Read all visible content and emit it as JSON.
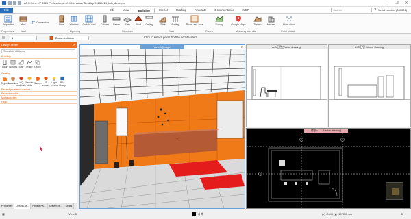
{
  "window": {
    "title": "ARCHLine.XP 2023 Professional - C:\\Users\\user\\Desktop\\20231229_info_deck.pro",
    "controls": [
      "—",
      "❐",
      "✕"
    ]
  },
  "menu": {
    "tabs": [
      "File",
      "Edit",
      "View",
      "Building",
      "Interior",
      "Drafting",
      "Annotate",
      "Documentation",
      "MEP"
    ],
    "active_tab": "Building",
    "search_placeholder": "Search",
    "serial": "Serial number (030001)"
  },
  "ribbon": {
    "buttons": [
      {
        "label": "Properties",
        "icon": "properties-icon"
      },
      {
        "label": "Wall",
        "icon": "wall-icon"
      },
      {
        "label": "Connection",
        "icon": "connection-icon"
      },
      {
        "label": "Door",
        "icon": "door-icon"
      },
      {
        "label": "Window",
        "icon": "window-icon"
      },
      {
        "label": "Curtain wall",
        "icon": "curtain-wall-icon"
      },
      {
        "label": "Column",
        "icon": "column-icon"
      },
      {
        "label": "Beam",
        "icon": "beam-icon"
      },
      {
        "label": "Slab",
        "icon": "slab-icon"
      },
      {
        "label": "Roof",
        "icon": "roof-icon"
      },
      {
        "label": "Ceiling",
        "icon": "ceiling-icon"
      },
      {
        "label": "Stair",
        "icon": "stair-icon"
      },
      {
        "label": "Railing",
        "icon": "railing-icon"
      },
      {
        "label": "Room and area",
        "icon": "room-icon"
      },
      {
        "label": "Survey",
        "icon": "survey-icon"
      },
      {
        "label": "Google Maps",
        "icon": "map-icon"
      },
      {
        "label": "Terrain",
        "icon": "terrain-icon"
      },
      {
        "label": "Masses",
        "icon": "masses-icon"
      },
      {
        "label": "Point cloud",
        "icon": "point-cloud-icon"
      }
    ],
    "groups": [
      "Properties",
      "Wall",
      "Opening",
      "Structure",
      "Stair",
      "Room",
      "Massing and site",
      "Point cloud"
    ]
  },
  "toolbar2": {
    "layer_value": "1",
    "style_value": "Documentation",
    "hint": "Click to select, press Shift to add/deselect"
  },
  "left_panel": {
    "title": "Design center",
    "search_placeholder": "Search in all items",
    "building_label": "Building",
    "building_items": [
      "Door",
      "Window",
      "Stair",
      "Profile",
      "Group"
    ],
    "catalog_label": "Catalog",
    "catalog_items": [
      "Objects",
      "Materials",
      "HQ materials",
      "Render style",
      "Shower",
      "3D scenes",
      "Light source",
      "BIM library"
    ],
    "sections": [
      "Recently created content",
      "Recent models",
      "My favourites",
      "Help"
    ],
    "bottom_tabs": [
      "Properties",
      "Design ce...",
      "Project na...",
      "System br...",
      "Styles"
    ]
  },
  "views": {
    "view3d_title": "View 3 [Image]",
    "top_left_title": "A-A 단면 [Vector drawing]",
    "top_right_title": "C-C 단면 [Vector drawing]",
    "bottom_title": "평면도 - 1 [Vector drawing]"
  },
  "status": {
    "view_label": "View 3",
    "layer_label": "가벽",
    "coords": "(x) -2446  (y) -1075.2 mm"
  },
  "colors": {
    "accent": "#f06a1c",
    "wall_orange": "#f07a18",
    "floor_red": "#e41c1c",
    "desk_wood": "#b45a34",
    "view_border": "#6aa0d8"
  }
}
